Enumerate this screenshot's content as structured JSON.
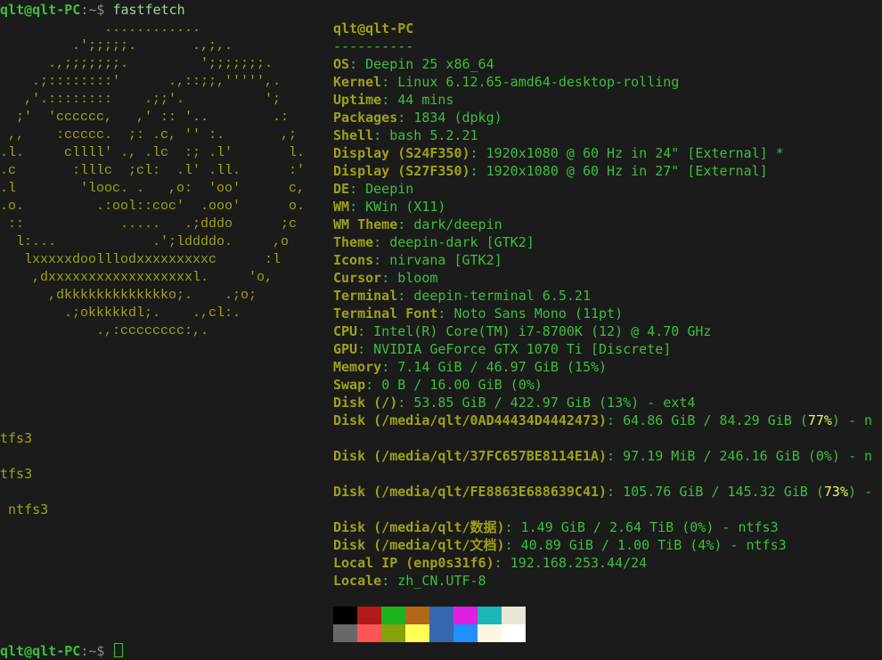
{
  "prompt_top": {
    "user": "qlt@qlt-PC",
    "sep": ":~$ ",
    "cmd": "fastfetch"
  },
  "prompt_bottom": {
    "user": "qlt@qlt-PC",
    "sep": ":~$ "
  },
  "logo_lines": [
    "             ............",
    "         .';;;;;.       .,;,.",
    "      .,;;;;;;;.         ';;;;;;;.",
    "    .;::::::::'      .,::;;,''''',.",
    "   ,'.::::::::    .;;'.          ';",
    "  ;'  'cccccc,   ,' :: '..        .:",
    " ,,    :ccccc.  ;: .c, '' :.       ,;",
    ".l.     cllll' ., .lc  :; .l'       l.",
    ".c       :lllc  ;cl:  .l' .ll.      :'",
    ".l        'looc. .   ,o:  'oo'      c,",
    ".o.         .:ool::coc'  .ooo'      o.",
    " ::            .....   .;dddo      ;c",
    "  l:...            .';lddddo.     ,o",
    "   lxxxxxdoolllodxxxxxxxxxc      :l",
    "    ,dxxxxxxxxxxxxxxxxxxl.     'o,",
    "      ,dkkkkkkkkkkkkko;.    .;o;",
    "        .;okkkkkdl;.    .,cl:.",
    "            .,:cccccccc:,."
  ],
  "wrap_frags": [
    "tfs3",
    "tfs3",
    " ntfs3"
  ],
  "header": {
    "user": "qlt",
    "at": "@",
    "host": "qlt-PC",
    "underline": "----------"
  },
  "info": [
    {
      "key": "OS",
      "value": "Deepin 25 x86_64"
    },
    {
      "key": "Kernel",
      "value": "Linux 6.12.65-amd64-desktop-rolling"
    },
    {
      "key": "Uptime",
      "value": "44 mins"
    },
    {
      "key": "Packages",
      "value": "1834 (dpkg)"
    },
    {
      "key": "Shell",
      "value": "bash 5.2.21"
    },
    {
      "key": "Display (S24F350)",
      "value": "1920x1080 @ 60 Hz in 24\" [External] *"
    },
    {
      "key": "Display (S27F350)",
      "value": "1920x1080 @ 60 Hz in 27\" [External]"
    },
    {
      "key": "DE",
      "value": "Deepin"
    },
    {
      "key": "WM",
      "value": "KWin (X11)"
    },
    {
      "key": "WM Theme",
      "value": "dark/deepin"
    },
    {
      "key": "Theme",
      "value": "deepin-dark [GTK2]"
    },
    {
      "key": "Icons",
      "value": "nirvana [GTK2]"
    },
    {
      "key": "Cursor",
      "value": "bloom"
    },
    {
      "key": "Terminal",
      "value": "deepin-terminal 6.5.21"
    },
    {
      "key": "Terminal Font",
      "value": "Noto Sans Mono (11pt)"
    },
    {
      "key": "CPU",
      "value": "Intel(R) Core(TM) i7-8700K (12) @ 4.70 GHz"
    },
    {
      "key": "GPU",
      "value": "NVIDIA GeForce GTX 1070 Ti [Discrete]"
    },
    {
      "key": "Memory",
      "value": "7.14 GiB / 46.97 GiB (15%)"
    },
    {
      "key": "Swap",
      "value": "0 B / 16.00 GiB (0%)"
    },
    {
      "key": "Disk (/)",
      "value": "53.85 GiB / 422.97 GiB (13%) - ext4"
    },
    {
      "key": "Disk (/media/qlt/0AD44434D4442473)",
      "pre": "64.86 GiB / 84.29 GiB (",
      "hl": "77%",
      "post": ") - n"
    },
    {
      "blank": true
    },
    {
      "key": "Disk (/media/qlt/37FC657BE8114E1A)",
      "value": "97.19 MiB / 246.16 GiB (0%) - n"
    },
    {
      "blank": true
    },
    {
      "key": "Disk (/media/qlt/FE8863E688639C41)",
      "pre": "105.76 GiB / 145.32 GiB (",
      "hl": "73%",
      "post": ") -"
    },
    {
      "blank": true
    },
    {
      "key": "Disk (/media/qlt/数据)",
      "value": "1.49 GiB / 2.64 TiB (0%) - ntfs3"
    },
    {
      "key": "Disk (/media/qlt/文档)",
      "value": "40.89 GiB / 1.00 TiB (4%) - ntfs3"
    },
    {
      "key": "Local IP (enp0s31f6)",
      "value": "192.168.253.44/24"
    },
    {
      "key": "Locale",
      "value": "zh_CN.UTF-8"
    }
  ],
  "palette": {
    "row1": [
      "#000000",
      "#b21a1a",
      "#1db31d",
      "#b26818",
      "#3567b0",
      "#e01fe0",
      "#1ab7b7",
      "#eae6d4"
    ],
    "row2": [
      "#686868",
      "#ff5555",
      "#86a10a",
      "#ffff55",
      "#3567b0",
      "#1e90ff",
      "#fdf6e3",
      "#ffffff"
    ]
  },
  "colors": {
    "background": "#1b1b1b",
    "key": "#a0a019",
    "value": "#3cbf3c",
    "highlight": "#f0f062"
  }
}
